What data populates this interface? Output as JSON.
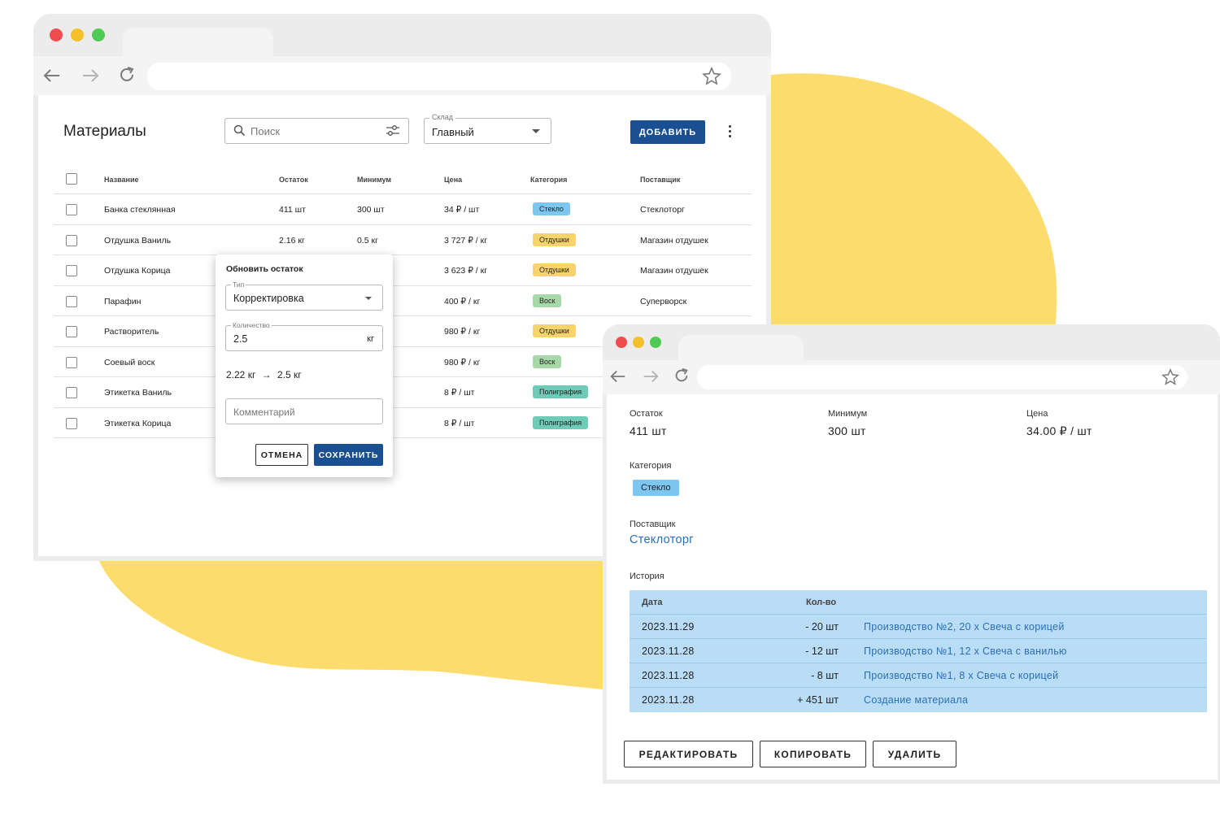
{
  "colors": {
    "accent": "#1a4f91",
    "link": "#2a6fb5",
    "backdrop_blob": "#fddc6e",
    "chip_glass": "#7cc6f2",
    "chip_aroma": "#f8d36b",
    "chip_wax": "#a6d8a8",
    "chip_print": "#6ecbb7",
    "history_bg": "#b9dcf7"
  },
  "materials_window": {
    "title": "Материалы",
    "search": {
      "placeholder": "Поиск",
      "icon": "search-icon",
      "filter_icon": "sliders-icon"
    },
    "warehouse": {
      "label": "Склад",
      "value": "Главный"
    },
    "add_button": "ДОБАВИТЬ",
    "more_icon": "more-vert-icon",
    "columns": [
      "Название",
      "Остаток",
      "Минимум",
      "Цена",
      "Категория",
      "Поставщик"
    ],
    "rows": [
      {
        "name": "Банка стеклянная",
        "stock": "411 шт",
        "min": "300 шт",
        "price": "34 ₽ / шт",
        "category": "Стекло",
        "cat_type": "glass",
        "supplier": "Стеклоторг"
      },
      {
        "name": "Отдушка Ваниль",
        "stock": "2.16 кг",
        "min": "0.5 кг",
        "price": "3 727 ₽ / кг",
        "category": "Отдушки",
        "cat_type": "aroma",
        "supplier": "Магазин отдушек"
      },
      {
        "name": "Отдушка Корица",
        "stock": "",
        "min": "",
        "price": "3 623 ₽ / кг",
        "category": "Отдушки",
        "cat_type": "aroma",
        "supplier": "Магазин отдушек"
      },
      {
        "name": "Парафин",
        "stock": "",
        "min": "",
        "price": "400 ₽ / кг",
        "category": "Воск",
        "cat_type": "wax",
        "supplier": "Суперворск"
      },
      {
        "name": "Растворитель",
        "stock": "",
        "min": "",
        "price": "980 ₽ / кг",
        "category": "Отдушки",
        "cat_type": "aroma",
        "supplier": ""
      },
      {
        "name": "Соевый воск",
        "stock": "",
        "min": "",
        "price": "980 ₽ / кг",
        "category": "Воск",
        "cat_type": "wax",
        "supplier": ""
      },
      {
        "name": "Этикетка Ваниль",
        "stock": "",
        "min": "",
        "price": "8 ₽ / шт",
        "category": "Полиграфия",
        "cat_type": "print",
        "supplier": ""
      },
      {
        "name": "Этикетка Корица",
        "stock": "",
        "min": "",
        "price": "8 ₽ / шт",
        "category": "Полиграфия",
        "cat_type": "print",
        "supplier": ""
      }
    ],
    "popup": {
      "title": "Обновить остаток",
      "type_label": "Тип",
      "type_value": "Корректировка",
      "qty_label": "Количество",
      "qty_value": "2.5",
      "qty_unit": "кг",
      "change_from": "2.22 кг",
      "change_to": "2.5 кг",
      "comment_placeholder": "Комментарий",
      "cancel": "ОТМЕНА",
      "save": "СОХРАНИТЬ"
    }
  },
  "detail_window": {
    "stock_label": "Остаток",
    "stock_value": "411 шт",
    "min_label": "Минимум",
    "min_value": "300 шт",
    "price_label": "Цена",
    "price_value": "34.00 ₽ / шт",
    "category_label": "Категория",
    "category_value": "Стекло",
    "supplier_label": "Поставщик",
    "supplier_value": "Стеклоторг",
    "history_label": "История",
    "history_columns": [
      "Дата",
      "Кол-во"
    ],
    "history": [
      {
        "date": "2023.11.29",
        "qty": "- 20 шт",
        "note": "Производство №2, 20 x Свеча с корицей"
      },
      {
        "date": "2023.11.28",
        "qty": "- 12 шт",
        "note": "Производство №1, 12 x Свеча с ванилью"
      },
      {
        "date": "2023.11.28",
        "qty": "- 8 шт",
        "note": "Производство №1, 8 x Свеча с корицей"
      },
      {
        "date": "2023.11.28",
        "qty": "+ 451 шт",
        "note": "Создание материала"
      }
    ],
    "buttons": {
      "edit": "РЕДАКТИРОВАТЬ",
      "copy": "КОПИРОВАТЬ",
      "delete": "УДАЛИТЬ"
    }
  }
}
